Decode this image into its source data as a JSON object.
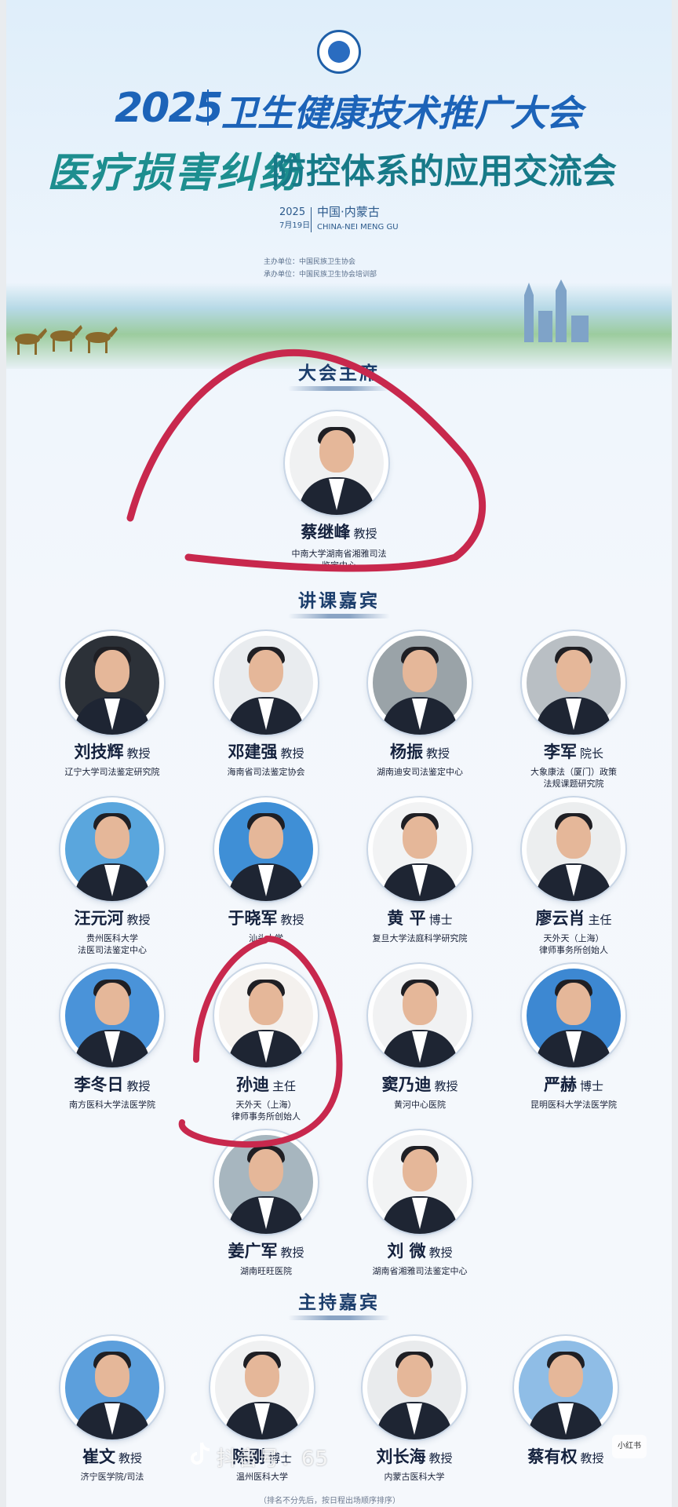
{
  "header": {
    "year": "2025",
    "conference": "卫生健康技术推广大会",
    "subtitle_script": "医疗损害纠纷",
    "subtitle": "防控体系的应用交流会",
    "date_year": "2025",
    "date": "7月19日",
    "location": "中国·内蒙古",
    "location_en": "CHINA-NEI MENG GU",
    "host": "主办单位：中国民族卫生协会",
    "organizer": "承办单位：中国民族卫生协会培训部"
  },
  "sections": {
    "chair": "大会主席",
    "speakers": "讲课嘉宾",
    "hosts": "主持嘉宾"
  },
  "chair": {
    "name": "蔡继峰",
    "title": "教授",
    "affiliation": [
      "中南大学湖南省湘雅司法",
      "鉴定中心"
    ]
  },
  "speakers": [
    {
      "name": "刘技辉",
      "title": "教授",
      "affiliation": [
        "辽宁大学司法鉴定研究院"
      ],
      "bg": "#2c3138"
    },
    {
      "name": "邓建强",
      "title": "教授",
      "affiliation": [
        "海南省司法鉴定协会"
      ],
      "bg": "#e9ecef"
    },
    {
      "name": "杨振",
      "title": "教授",
      "affiliation": [
        "湖南迪安司法鉴定中心"
      ],
      "bg": "#9aa3a8"
    },
    {
      "name": "李军",
      "title": "院长",
      "affiliation": [
        "大象康法（厦门）政策",
        "法规课题研究院"
      ],
      "bg": "#b9bfc4"
    },
    {
      "name": "汪元河",
      "title": "教授",
      "affiliation": [
        "贵州医科大学",
        "法医司法鉴定中心"
      ],
      "bg": "#5aa6dd"
    },
    {
      "name": "于晓军",
      "title": "教授",
      "affiliation": [
        "汕头大学"
      ],
      "bg": "#3f8fd6"
    },
    {
      "name": "黄 平",
      "title": "博士",
      "affiliation": [
        "复旦大学法庭科学研究院"
      ],
      "bg": "#f2f3f4"
    },
    {
      "name": "廖云肖",
      "title": "主任",
      "affiliation": [
        "天外天（上海）",
        "律师事务所创始人"
      ],
      "bg": "#eceeef"
    },
    {
      "name": "李冬日",
      "title": "教授",
      "affiliation": [
        "南方医科大学法医学院"
      ],
      "bg": "#4a93d9"
    },
    {
      "name": "孙迪",
      "title": "主任",
      "affiliation": [
        "天外天（上海）",
        "律师事务所创始人"
      ],
      "bg": "#f4f1ee"
    },
    {
      "name": "窦乃迪",
      "title": "教授",
      "affiliation": [
        "黄河中心医院"
      ],
      "bg": "#f1f2f3"
    },
    {
      "name": "严赫",
      "title": "博士",
      "affiliation": [
        "昆明医科大学法医学院"
      ],
      "bg": "#3d88d2"
    },
    {
      "name": "姜广军",
      "title": "教授",
      "affiliation": [
        "湖南旺旺医院"
      ],
      "bg": "#a7b6bf"
    },
    {
      "name": "刘 微",
      "title": "教授",
      "affiliation": [
        "湖南省湘雅司法鉴定中心"
      ],
      "bg": "#f2f3f4"
    }
  ],
  "hosts": [
    {
      "name": "崔文",
      "title": "教授",
      "affiliation": [
        "济宁医学院/司法"
      ],
      "bg": "#5c9fdc"
    },
    {
      "name": "陈刚",
      "title": "博士",
      "affiliation": [
        "温州医科大学"
      ],
      "bg": "#f0f1f2"
    },
    {
      "name": "刘长海",
      "title": "教授",
      "affiliation": [
        "内蒙古医科大学"
      ],
      "bg": "#e9ebed"
    },
    {
      "name": "蔡有权",
      "title": "教授",
      "affiliation": [
        ""
      ],
      "bg": "#8fbde6"
    }
  ],
  "footnote": "（排名不分先后，按日程出场顺序排序）",
  "watermark": "抖音号：65",
  "corner_badge": "小红书",
  "colors": {
    "title_blue": "#1c63b8",
    "subtitle_teal": "#177a88",
    "annotation_red": "#c8284d",
    "text_dark": "#14213d"
  }
}
